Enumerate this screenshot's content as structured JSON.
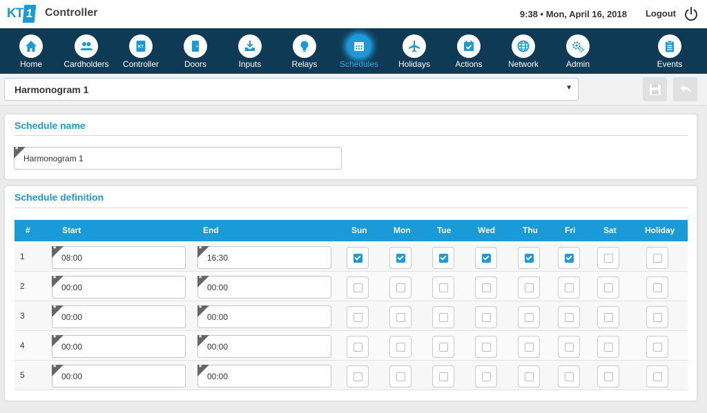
{
  "header": {
    "logo_text": "KT",
    "logo_num": "1",
    "title": "Controller",
    "datetime": "9:38 • Mon, April 16, 2018",
    "logout_label": "Logout"
  },
  "nav": {
    "items": [
      {
        "label": "Home",
        "icon": "home-icon"
      },
      {
        "label": "Cardholders",
        "icon": "users-icon"
      },
      {
        "label": "Controller",
        "icon": "controller-icon"
      },
      {
        "label": "Doors",
        "icon": "door-icon"
      },
      {
        "label": "Inputs",
        "icon": "input-icon"
      },
      {
        "label": "Relays",
        "icon": "bulb-icon"
      },
      {
        "label": "Schedules",
        "icon": "calendar-icon",
        "active": true
      },
      {
        "label": "Holidays",
        "icon": "plane-icon"
      },
      {
        "label": "Actions",
        "icon": "calendar-check-icon"
      },
      {
        "label": "Network",
        "icon": "globe-icon"
      },
      {
        "label": "Admin",
        "icon": "gears-icon"
      },
      {
        "label": "Events",
        "icon": "clipboard-icon"
      }
    ]
  },
  "selector": {
    "value": "Harmonogram 1"
  },
  "name_panel": {
    "title": "Schedule name",
    "value": "Harmonogram 1"
  },
  "definition_panel": {
    "title": "Schedule definition",
    "columns": [
      "#",
      "Start",
      "End",
      "Sun",
      "Mon",
      "Tue",
      "Wed",
      "Thu",
      "Fri",
      "Sat",
      "Holiday"
    ],
    "rows": [
      {
        "num": "1",
        "start": "08:00",
        "end": "16:30",
        "days": [
          true,
          true,
          true,
          true,
          true,
          true,
          false,
          false
        ]
      },
      {
        "num": "2",
        "start": "00:00",
        "end": "00:00",
        "days": [
          false,
          false,
          false,
          false,
          false,
          false,
          false,
          false
        ]
      },
      {
        "num": "3",
        "start": "00:00",
        "end": "00:00",
        "days": [
          false,
          false,
          false,
          false,
          false,
          false,
          false,
          false
        ]
      },
      {
        "num": "4",
        "start": "00:00",
        "end": "00:00",
        "days": [
          false,
          false,
          false,
          false,
          false,
          false,
          false,
          false
        ]
      },
      {
        "num": "5",
        "start": "00:00",
        "end": "00:00",
        "days": [
          false,
          false,
          false,
          false,
          false,
          false,
          false,
          false
        ]
      }
    ]
  },
  "colors": {
    "accent": "#1a9ad6",
    "nav_bg": "#0e3a55"
  }
}
